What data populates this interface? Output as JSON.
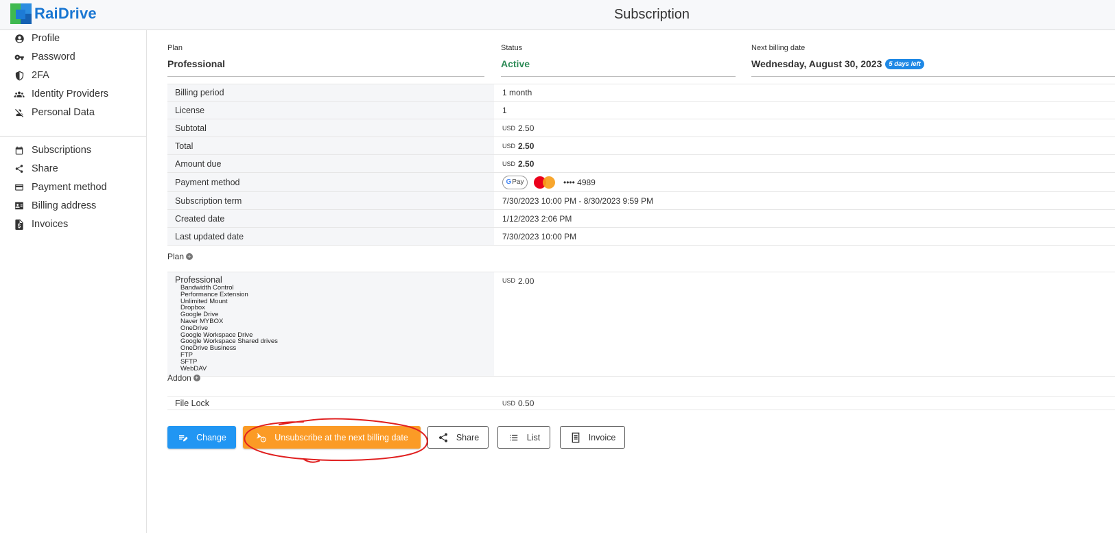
{
  "app": {
    "logo_text": "RaiDrive",
    "page_title": "Subscription"
  },
  "sidebar": {
    "account_items": [
      {
        "label": "Profile",
        "icon": "account-circle-icon"
      },
      {
        "label": "Password",
        "icon": "key-icon"
      },
      {
        "label": "2FA",
        "icon": "shield-half-icon"
      },
      {
        "label": "Identity Providers",
        "icon": "account-group-icon"
      },
      {
        "label": "Personal Data",
        "icon": "account-off-icon"
      }
    ],
    "billing_items": [
      {
        "label": "Subscriptions",
        "icon": "calendar-icon"
      },
      {
        "label": "Share",
        "icon": "share-icon"
      },
      {
        "label": "Payment method",
        "icon": "credit-card-icon"
      },
      {
        "label": "Billing address",
        "icon": "id-card-icon"
      },
      {
        "label": "Invoices",
        "icon": "invoice-dollar-icon"
      }
    ]
  },
  "summary": {
    "plan_label": "Plan",
    "plan_value": "Professional",
    "status_label": "Status",
    "status_value": "Active",
    "status_color": "#2e8b57",
    "next_billing_label": "Next billing date",
    "next_billing_value": "Wednesday, August 30, 2023",
    "days_left_badge": "5 days left"
  },
  "details": {
    "billing_period_label": "Billing period",
    "billing_period_value": "1 month",
    "license_label": "License",
    "license_value": "1",
    "subtotal_label": "Subtotal",
    "subtotal_currency": "USD",
    "subtotal_value": "2.50",
    "total_label": "Total",
    "total_currency": "USD",
    "total_value": "2.50",
    "amount_due_label": "Amount due",
    "amount_due_currency": "USD",
    "amount_due_value": "2.50",
    "payment_method_label": "Payment method",
    "gpay_g": "G",
    "gpay_text": "Pay",
    "card_number": "•••• 4989",
    "subscription_term_label": "Subscription term",
    "subscription_term_value": "7/30/2023 10:00 PM - 8/30/2023 9:59 PM",
    "created_date_label": "Created date",
    "created_date_value": "1/12/2023 2:06 PM",
    "last_updated_label": "Last updated date",
    "last_updated_value": "7/30/2023 10:00 PM"
  },
  "plan_section": {
    "header": "Plan",
    "name": "Professional",
    "currency": "USD",
    "price": "2.00",
    "features": [
      "Bandwidth Control",
      "Performance Extension",
      "Unlimited Mount",
      "Dropbox",
      "Google Drive",
      "Naver MYBOX",
      "OneDrive",
      "Google Workspace Drive",
      "Google Workspace Shared drives",
      "OneDrive Business",
      "FTP",
      "SFTP",
      "WebDAV"
    ]
  },
  "addon_section": {
    "header": "Addon",
    "name": "File Lock",
    "currency": "USD",
    "price": "0.50"
  },
  "actions": {
    "change_label": "Change",
    "unsubscribe_label": "Unsubscribe at the next billing date",
    "share_label": "Share",
    "list_label": "List",
    "invoice_label": "Invoice"
  },
  "colors": {
    "primary": "#2196f3",
    "warning": "#fb9b26",
    "badge": "#1e88e5",
    "annotation": "#e02020"
  }
}
